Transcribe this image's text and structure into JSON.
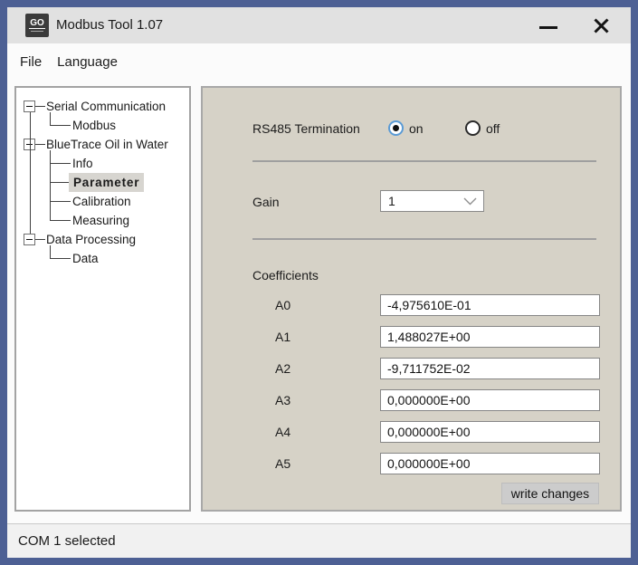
{
  "window": {
    "title": "Modbus Tool 1.07",
    "icon_text": "GO",
    "controls": {
      "minimize_icon": "minimize-icon",
      "close_icon": "close-icon"
    }
  },
  "menu": {
    "items": [
      "File",
      "Language"
    ]
  },
  "tree": {
    "items": [
      {
        "label": "Serial Communication",
        "level": 0,
        "expanded": true
      },
      {
        "label": "Modbus",
        "level": 1
      },
      {
        "label": "BlueTrace Oil in Water",
        "level": 0,
        "expanded": true
      },
      {
        "label": "Info",
        "level": 1
      },
      {
        "label": "Parameter",
        "level": 1,
        "selected": true
      },
      {
        "label": "Calibration",
        "level": 1
      },
      {
        "label": "Measuring",
        "level": 1
      },
      {
        "label": "Data Processing",
        "level": 0,
        "expanded": true
      },
      {
        "label": "Data",
        "level": 1
      }
    ]
  },
  "panel": {
    "rs485": {
      "label": "RS485 Termination",
      "options": [
        {
          "label": "on",
          "selected": true
        },
        {
          "label": "off",
          "selected": false
        }
      ]
    },
    "gain": {
      "label": "Gain",
      "value": "1",
      "chevron_icon": "chevron-down-icon"
    },
    "coefficients": {
      "label": "Coefficients",
      "rows": [
        {
          "name": "A0",
          "value": "-4,975610E-01"
        },
        {
          "name": "A1",
          "value": "1,488027E+00"
        },
        {
          "name": "A2",
          "value": "-9,711752E-02"
        },
        {
          "name": "A3",
          "value": "0,000000E+00"
        },
        {
          "name": "A4",
          "value": "0,000000E+00"
        },
        {
          "name": "A5",
          "value": "0,000000E+00"
        }
      ]
    },
    "write_button": "write changes"
  },
  "statusbar": {
    "text": "COM 1 selected"
  },
  "colors": {
    "frame_border": "#4d6094",
    "titlebar_bg": "#e1e1e1",
    "panel_bg": "#d6d2c7",
    "radio_accent": "#5b9bd5",
    "selected_item_bg": "#d7d5d0"
  }
}
